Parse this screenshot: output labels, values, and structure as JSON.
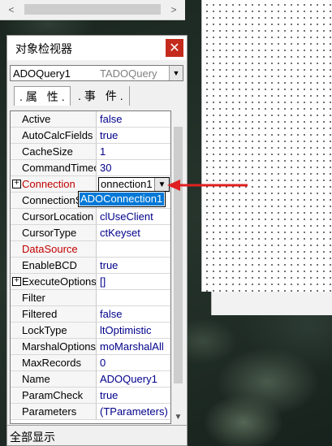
{
  "scrollbar_top": {
    "left_arrow": "<",
    "right_arrow": ">"
  },
  "inspector": {
    "title": "对象检视器",
    "close_glyph": "✕",
    "object_name": "ADOQuery1",
    "object_type": "TADOQuery",
    "tabs": [
      {
        "label": ".属 性.",
        "active": true
      },
      {
        "label": ".事 件.",
        "active": false
      }
    ],
    "properties": [
      {
        "name": "Active",
        "value": "false"
      },
      {
        "name": "AutoCalcFields",
        "value": "true"
      },
      {
        "name": "CacheSize",
        "value": "1"
      },
      {
        "name": "CommandTimeout",
        "value": "30"
      },
      {
        "name": "Connection",
        "value": "ADOConnection1",
        "expandable": true,
        "highlight": true
      },
      {
        "name": "ConnectionString",
        "value": ""
      },
      {
        "name": "CursorLocation",
        "value": "clUseClient"
      },
      {
        "name": "CursorType",
        "value": "ctKeyset"
      },
      {
        "name": "DataSource",
        "value": "",
        "highlight": true
      },
      {
        "name": "EnableBCD",
        "value": "true"
      },
      {
        "name": "ExecuteOptions",
        "value": "[]",
        "expandable": true
      },
      {
        "name": "Filter",
        "value": ""
      },
      {
        "name": "Filtered",
        "value": "false"
      },
      {
        "name": "LockType",
        "value": "ltOptimistic"
      },
      {
        "name": "MarshalOptions",
        "value": "moMarshalAll"
      },
      {
        "name": "MaxRecords",
        "value": "0"
      },
      {
        "name": "Name",
        "value": "ADOQuery1"
      },
      {
        "name": "ParamCheck",
        "value": "true"
      },
      {
        "name": "Parameters",
        "value": "(TParameters)"
      }
    ],
    "connection_combo_text": "onnection1",
    "dropdown_option": "ADOConnection1",
    "status": "全部显示"
  },
  "colors": {
    "close_button": "#c42b1c",
    "highlight_name": "#c00000",
    "value_text": "#00008b",
    "selection": "#0078d7",
    "annotation_arrow": "#e02020"
  }
}
